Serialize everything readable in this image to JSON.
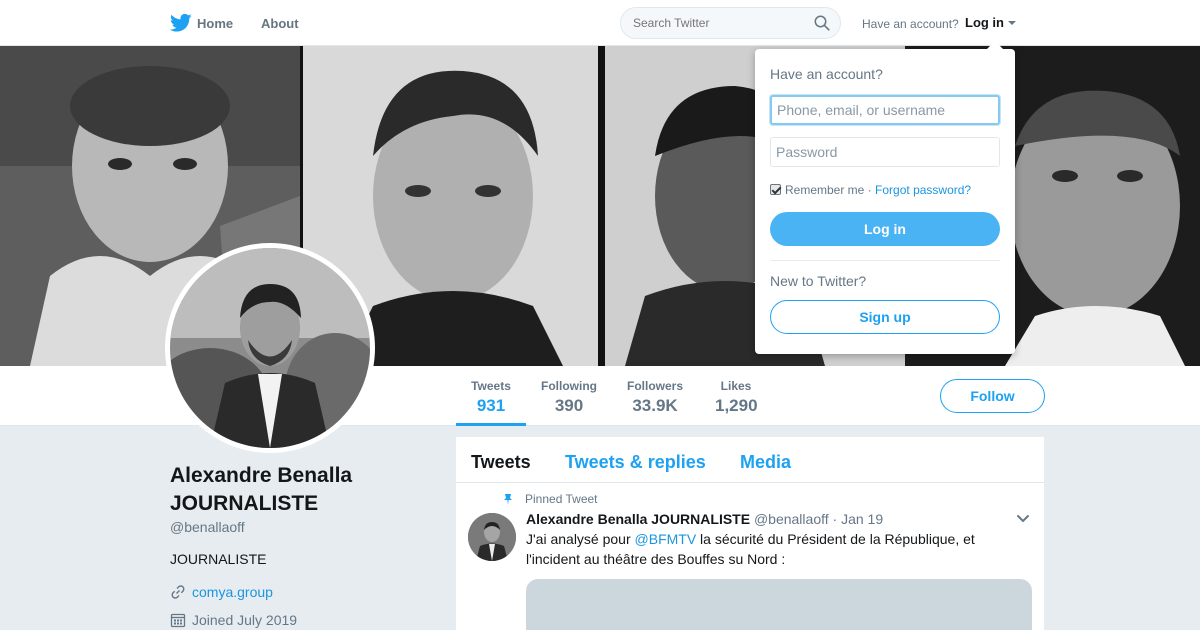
{
  "nav": {
    "logo_icon": "twitter-bird-icon",
    "home_label": "Home",
    "about_label": "About",
    "search_placeholder": "Search Twitter",
    "have_account": "Have an account?",
    "login_label": "Log in"
  },
  "stats": [
    {
      "label": "Tweets",
      "value": "931",
      "active": true
    },
    {
      "label": "Following",
      "value": "390",
      "active": false
    },
    {
      "label": "Followers",
      "value": "33.9K",
      "active": false
    },
    {
      "label": "Likes",
      "value": "1,290",
      "active": false
    }
  ],
  "follow_label": "Follow",
  "profile": {
    "name": "Alexandre Benalla JOURNALISTE",
    "handle": "@benallaoff",
    "bio": "JOURNALISTE",
    "link": "comya.group",
    "joined": "Joined July 2019"
  },
  "timeline": {
    "tabs": [
      "Tweets",
      "Tweets & replies",
      "Media"
    ],
    "pinned_label": "Pinned Tweet",
    "tweet": {
      "name": "Alexandre Benalla JOURNALISTE",
      "handle": "@benallaoff",
      "separator": "·",
      "date": "Jan 19",
      "text_before": "J'ai analysé pour ",
      "mention": "@BFMTV",
      "text_after": " la sécurité du Président de la République, et l'incident au théâtre des Bouffes su Nord :"
    }
  },
  "login_dropdown": {
    "heading": "Have an account?",
    "username_placeholder": "Phone, email, or username",
    "password_placeholder": "Password",
    "remember_label": "Remember me",
    "separator": "·",
    "forgot_label": "Forgot password?",
    "login_button": "Log in",
    "new_label": "New to Twitter?",
    "signup_button": "Sign up"
  },
  "colors": {
    "accent": "#1da1f2",
    "link": "#1b95e0",
    "login_button": "#4ab3f4",
    "page_bg": "#e6ecf0",
    "muted_text": "#657786"
  }
}
